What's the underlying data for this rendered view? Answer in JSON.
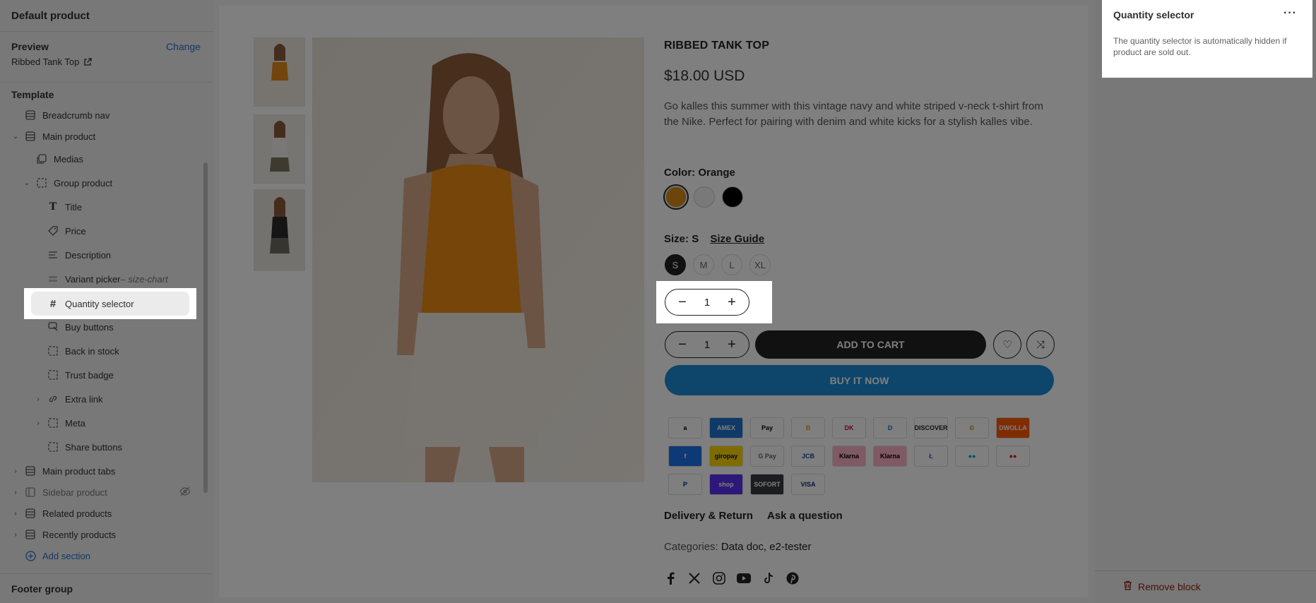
{
  "sidebar": {
    "title": "Default product",
    "preview_label": "Preview",
    "change_label": "Change",
    "preview_value": "Ribbed Tank Top",
    "template_label": "Template",
    "items": [
      {
        "label": "Breadcrumb nav"
      },
      {
        "label": "Main product"
      },
      {
        "label": "Medias"
      },
      {
        "label": "Group product"
      },
      {
        "label": "Title"
      },
      {
        "label": "Price"
      },
      {
        "label": "Description"
      },
      {
        "label": "Variant picker",
        "suffix": " – size-chart"
      },
      {
        "label": "Quantity selector"
      },
      {
        "label": "Buy buttons"
      },
      {
        "label": "Back in stock"
      },
      {
        "label": "Trust badge"
      },
      {
        "label": "Extra link"
      },
      {
        "label": "Meta"
      },
      {
        "label": "Share buttons"
      },
      {
        "label": "Main product tabs"
      },
      {
        "label": "Sidebar product"
      },
      {
        "label": "Related products"
      },
      {
        "label": "Recently products"
      },
      {
        "label": "Add section"
      }
    ],
    "footer_group": "Footer group"
  },
  "product": {
    "title": "RIBBED TANK TOP",
    "price": "$18.00 USD",
    "description": "Go kalles this summer with this vintage navy and white striped v-neck t-shirt from the Nike. Perfect for pairing with denim and white kicks for a stylish kalles vibe.",
    "color_label": "Color:",
    "color_value": "Orange",
    "colors": [
      "#d98a17",
      "#f2f2f2",
      "#000000"
    ],
    "size_label": "Size:",
    "size_value": "S",
    "size_guide": "Size Guide",
    "sizes": [
      "S",
      "M",
      "L",
      "XL"
    ],
    "quantity": "1",
    "add_to_cart": "ADD TO CART",
    "buy_now": "BUY IT NOW",
    "payment_methods": [
      {
        "label": "a",
        "bg": "#ffffff",
        "fg": "#000000"
      },
      {
        "label": "AMEX",
        "bg": "#1f72cd",
        "fg": "#ffffff"
      },
      {
        "label": "Pay",
        "bg": "#ffffff",
        "fg": "#000000"
      },
      {
        "label": "B",
        "bg": "#ffffff",
        "fg": "#f7931a"
      },
      {
        "label": "DK",
        "bg": "#ffffff",
        "fg": "#c8102e"
      },
      {
        "label": "D",
        "bg": "#ffffff",
        "fg": "#0079be"
      },
      {
        "label": "DISCOVER",
        "bg": "#ffffff",
        "fg": "#231f20"
      },
      {
        "label": "Đ",
        "bg": "#ffffff",
        "fg": "#c2a633"
      },
      {
        "label": "DWOLLA",
        "bg": "#ff5a00",
        "fg": "#ffffff"
      },
      {
        "label": "f",
        "bg": "#1a73e8",
        "fg": "#ffffff"
      },
      {
        "label": "giropay",
        "bg": "#ffd800",
        "fg": "#000268"
      },
      {
        "label": "G Pay",
        "bg": "#ffffff",
        "fg": "#5f6368"
      },
      {
        "label": "JCB",
        "bg": "#ffffff",
        "fg": "#0e4c96"
      },
      {
        "label": "Klarna",
        "bg": "#ffb3c7",
        "fg": "#000000"
      },
      {
        "label": "Klarna",
        "bg": "#ffb3c7",
        "fg": "#000000"
      },
      {
        "label": "Ł",
        "bg": "#ffffff",
        "fg": "#345d9d"
      },
      {
        "label": "●●",
        "bg": "#ffffff",
        "fg": "#0099df"
      },
      {
        "label": "●●",
        "bg": "#ffffff",
        "fg": "#eb001b"
      },
      {
        "label": "P",
        "bg": "#ffffff",
        "fg": "#003087"
      },
      {
        "label": "shop",
        "bg": "#5a31f4",
        "fg": "#ffffff"
      },
      {
        "label": "SOFORT",
        "bg": "#393a41",
        "fg": "#ffffff"
      },
      {
        "label": "VISA",
        "bg": "#ffffff",
        "fg": "#1a1f71"
      }
    ],
    "tab_delivery": "Delivery & Return",
    "tab_question": "Ask a question",
    "categories_label": "Categories:",
    "categories_value": "Data doc, e2-tester"
  },
  "right_panel": {
    "title": "Quantity selector",
    "more": "···",
    "info": "The quantity selector is automatically hidden if product are sold out.",
    "remove": "Remove block"
  },
  "colors": {
    "accent": "#2c6ecb",
    "buy_now": "#1a8bd6",
    "remove": "#8e1f0b"
  }
}
